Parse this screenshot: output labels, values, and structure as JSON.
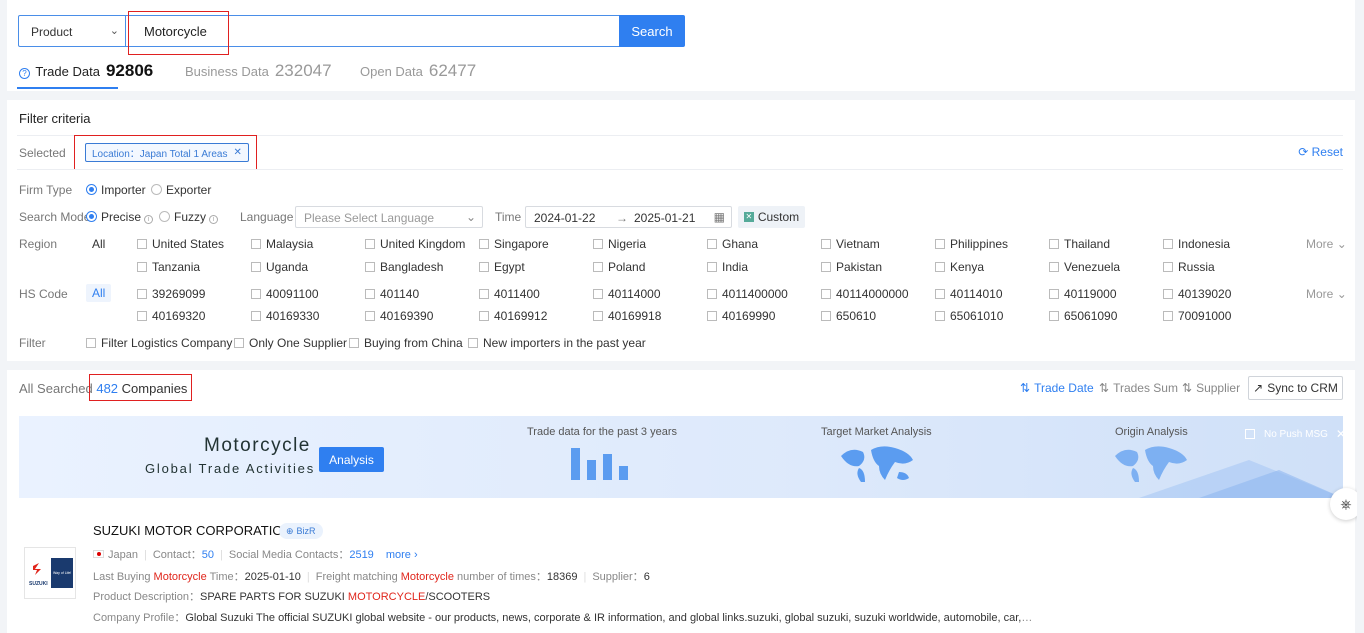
{
  "search": {
    "type_value": "Product",
    "query": "Motorcycle",
    "button": "Search"
  },
  "tabs": [
    {
      "label": "Trade Data",
      "count": "92806"
    },
    {
      "label": "Business Data",
      "count": "232047"
    },
    {
      "label": "Open Data",
      "count": "62477"
    }
  ],
  "filter": {
    "title": "Filter criteria",
    "selected_label": "Selected",
    "selected_tag": "Location：Japan Total 1 Areas",
    "reset": "Reset",
    "firm_type": {
      "label": "Firm Type",
      "options": [
        "Importer",
        "Exporter"
      ],
      "selected": "Importer"
    },
    "search_mode": {
      "label": "Search Mode",
      "options": [
        "Precise",
        "Fuzzy"
      ],
      "selected": "Precise"
    },
    "language": {
      "label": "Language",
      "placeholder": "Please Select Language"
    },
    "time": {
      "label": "Time",
      "start": "2024-01-22",
      "arrow": "→",
      "end": "2025-01-21",
      "custom": "Custom"
    },
    "region": {
      "label": "Region",
      "all": "All",
      "more": "More",
      "row1": [
        "United States",
        "Malaysia",
        "United Kingdom",
        "Singapore",
        "Nigeria",
        "Ghana",
        "Vietnam",
        "Philippines",
        "Thailand",
        "Indonesia"
      ],
      "row2": [
        "Tanzania",
        "Uganda",
        "Bangladesh",
        "Egypt",
        "Poland",
        "India",
        "Pakistan",
        "Kenya",
        "Venezuela",
        "Russia"
      ]
    },
    "hs_code": {
      "label": "HS Code",
      "all": "All",
      "more": "More",
      "row1": [
        "39269099",
        "40091100",
        "401140",
        "4011400",
        "40114000",
        "4011400000",
        "40114000000",
        "40114010",
        "40119000",
        "40139020"
      ],
      "row2": [
        "40169320",
        "40169330",
        "40169390",
        "40169912",
        "40169918",
        "40169990",
        "650610",
        "65061010",
        "65061090",
        "70091000"
      ]
    },
    "extra": {
      "label": "Filter",
      "options": [
        "Filter Logistics Company",
        "Only One Supplier",
        "Buying from China",
        "New importers in the past year"
      ]
    }
  },
  "results": {
    "prefix": "All Searched",
    "count": "482",
    "suffix": "Companies",
    "sort": {
      "trade_date": "Trade Date",
      "trades_sum": "Trades Sum",
      "supplier": "Supplier"
    },
    "sync": "Sync to CRM"
  },
  "banner": {
    "title": "Motorcycle",
    "subtitle": "Global Trade Activities",
    "analysis_button": "Analysis",
    "trade_data_caption": "Trade data for the past 3 years",
    "target_market": "Target Market Analysis",
    "origin": "Origin Analysis",
    "no_push": "No Push MSG"
  },
  "company": {
    "name": "SUZUKI MOTOR CORPORATION",
    "badge": "BizR",
    "country": "Japan",
    "contact_label": "Contact：",
    "contact_value": "50",
    "social_label": "Social Media Contacts：",
    "social_value": "2519",
    "more": "more",
    "last_buying_pre": "Last Buying ",
    "last_buying_kw": "Motorcycle",
    "last_buying_post": " Time：",
    "last_buying_value": "2025-01-10",
    "freight_pre": "Freight matching ",
    "freight_kw": "Motorcycle",
    "freight_post": " number of times：",
    "freight_value": "18369",
    "supplier_label": "Supplier：",
    "supplier_value": "6",
    "desc_label": "Product Description：",
    "desc_pre": "SPARE PARTS FOR SUZUKI ",
    "desc_kw": "MOTORCYCLE",
    "desc_post": "/SCOOTERS",
    "profile_label": "Company Profile：",
    "profile_value": "Global Suzuki The official SUZUKI global website - our products, news, corporate & IR information, and global links.suzuki, global suzuki, suzuki worldwide, automobile, car, mot...",
    "logo_text": "SUZUKI",
    "logo_slogan": "Way of Life!"
  },
  "colors": {
    "accent": "#2f7ff0",
    "highlight": "#e0251b",
    "annotation": "#e02020"
  }
}
